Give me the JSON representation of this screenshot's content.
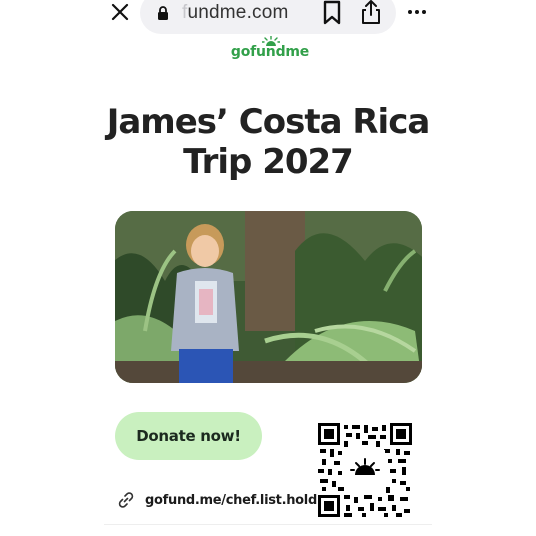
{
  "browser": {
    "url_faded_prefix": "f",
    "url_domain": "undme.com",
    "icons": [
      "close-icon",
      "lock-icon",
      "bookmark-icon",
      "share-icon",
      "more-icon"
    ]
  },
  "brand": {
    "logo_text": "gofundme",
    "color": "#32a04a"
  },
  "page": {
    "title_line1": "James’ Costa Rica",
    "title_line2": "Trip 2027"
  },
  "actions": {
    "donate_label": "Donate now!",
    "donate_color": "#c9f0bf",
    "short_link": "gofund.me/chef.list.hold"
  }
}
